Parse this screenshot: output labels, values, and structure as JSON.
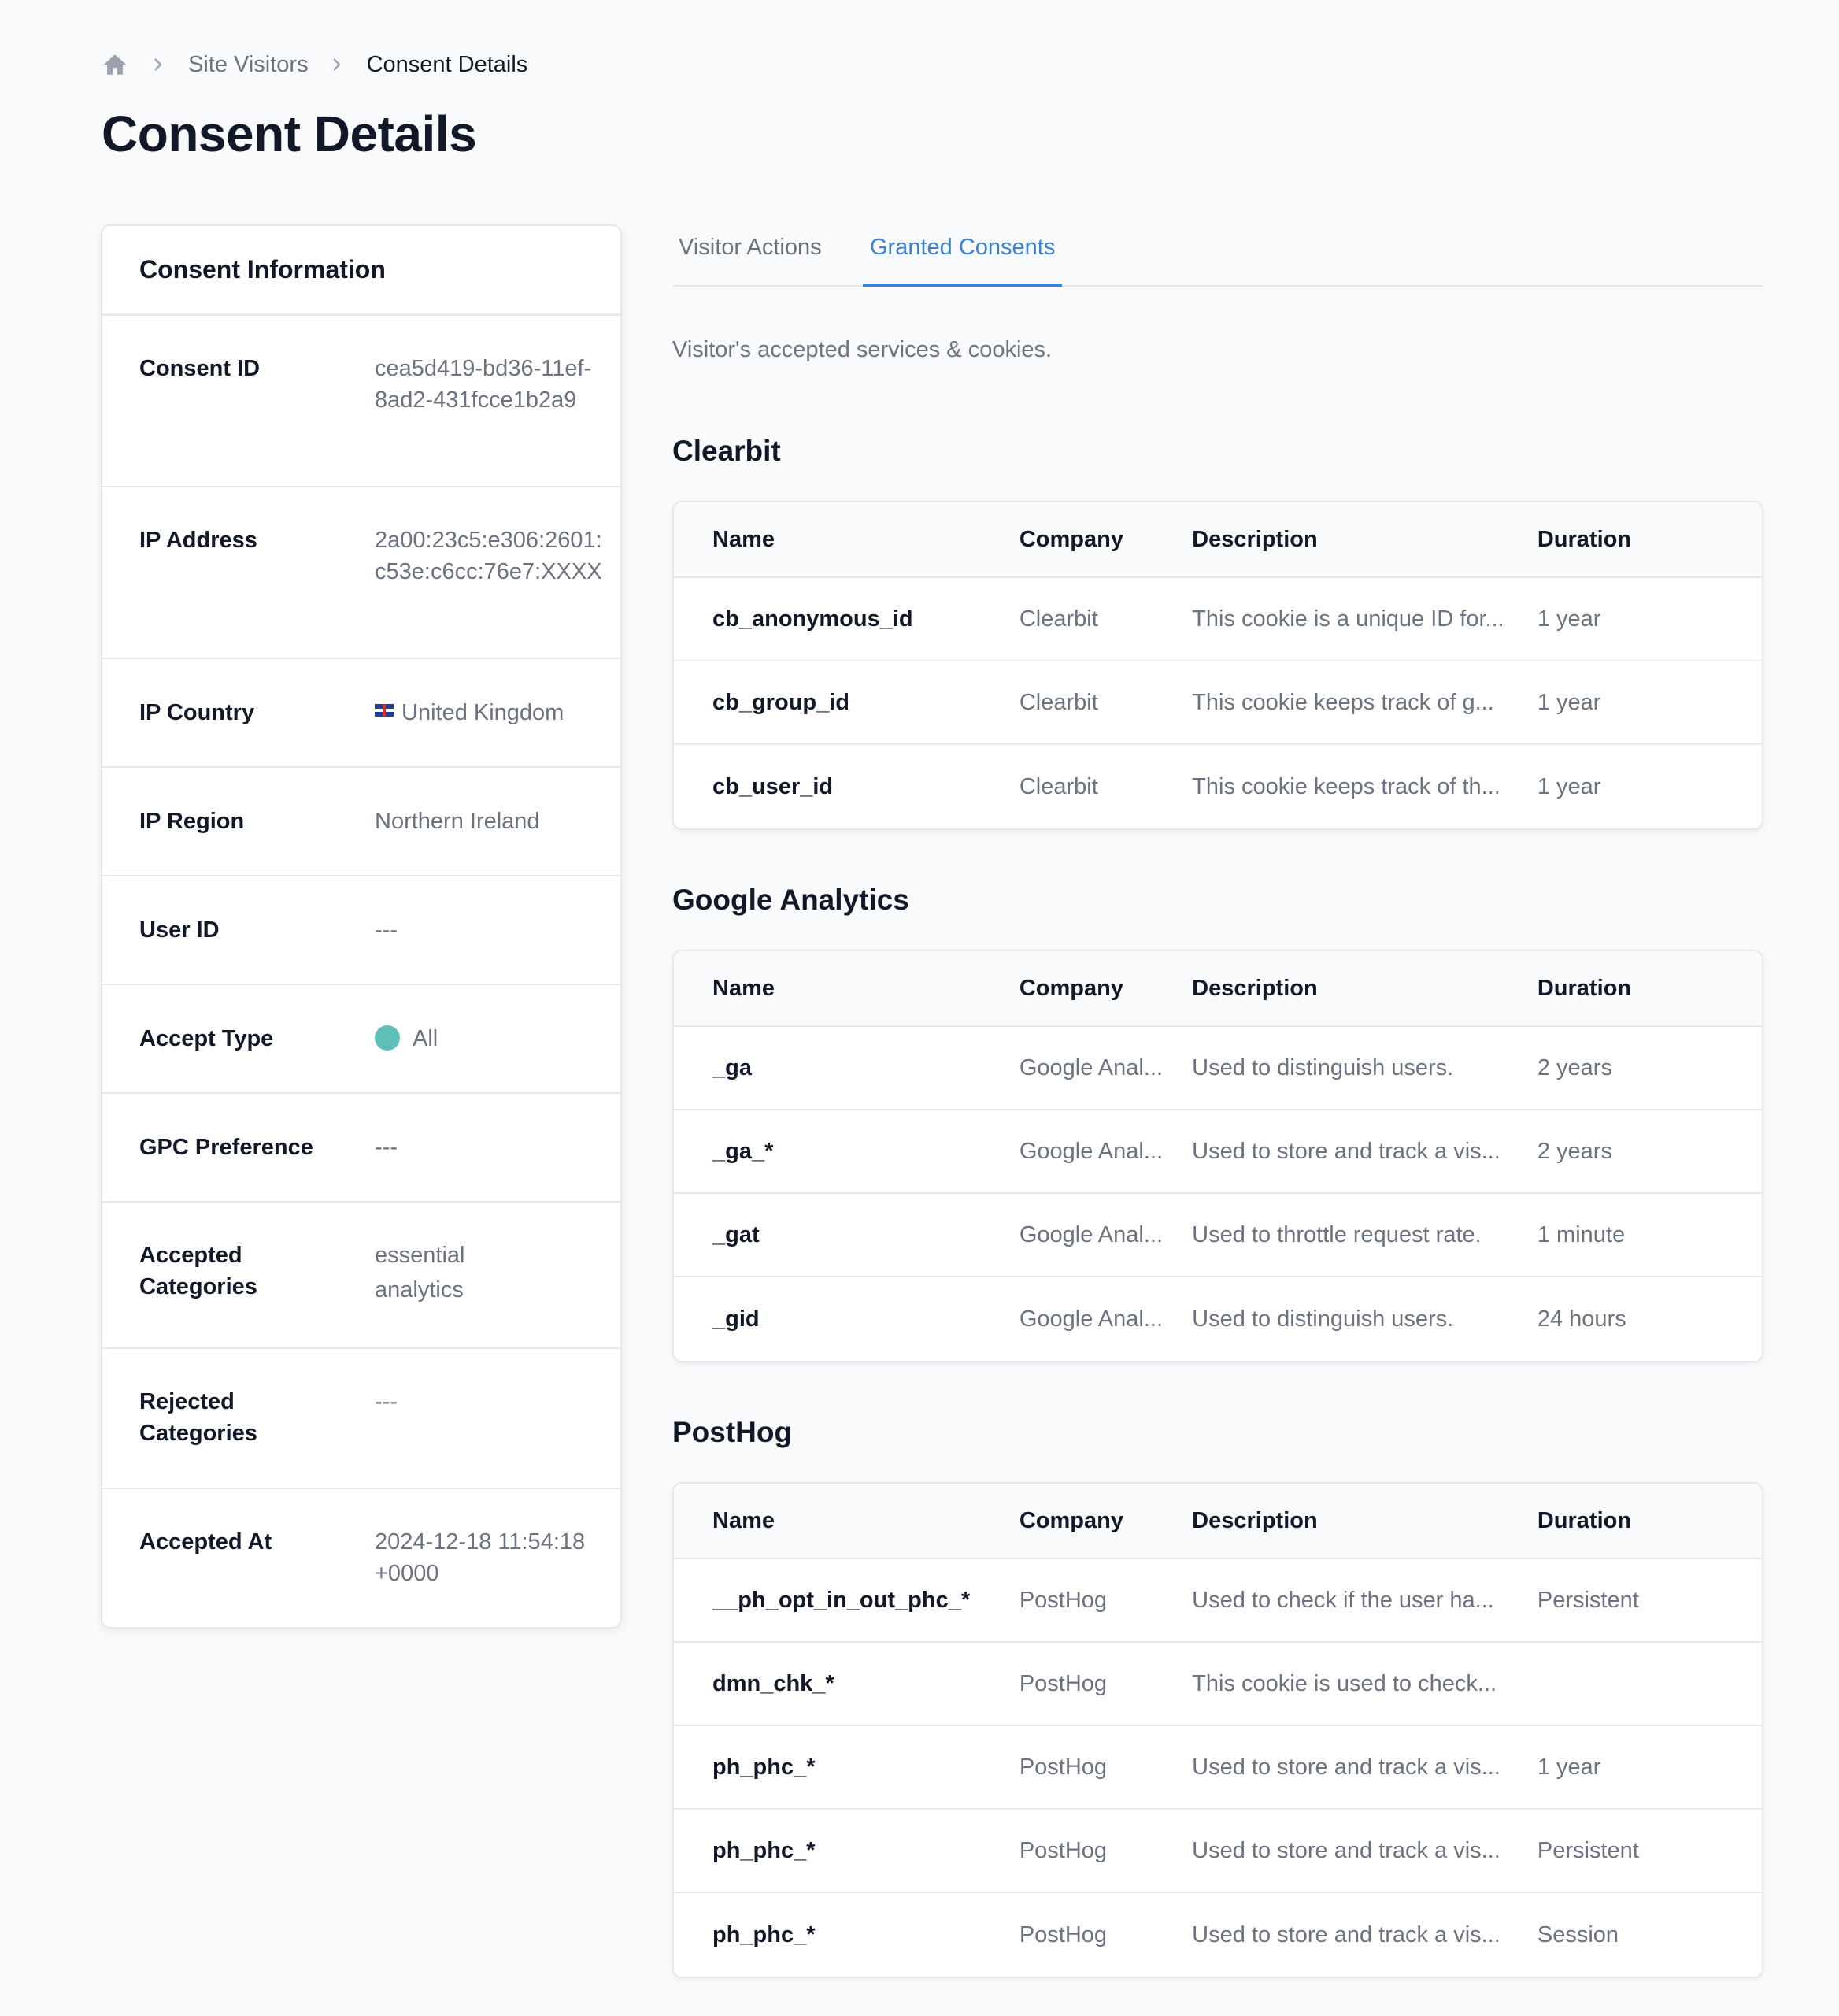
{
  "breadcrumb": {
    "home_icon": "home-icon",
    "items": [
      "Site Visitors",
      "Consent Details"
    ]
  },
  "page": {
    "title": "Consent Details"
  },
  "consent_info": {
    "title": "Consent Information",
    "rows": [
      {
        "label": "Consent ID",
        "value": "cea5d419-bd36-11ef-8ad2-431fcce1b2a9"
      },
      {
        "label": "IP Address",
        "value": "2a00:23c5:e306:2601:c53e:c6cc:76e7:XXXX"
      },
      {
        "label": "IP Country",
        "value": "United Kingdom",
        "icon": "uk-flag-icon"
      },
      {
        "label": "IP Region",
        "value": "Northern Ireland"
      },
      {
        "label": "User ID",
        "value": "---"
      },
      {
        "label": "Accept Type",
        "value": "All",
        "dot_color": "#5fc0b8"
      },
      {
        "label": "GPC Preference",
        "value": "---"
      },
      {
        "label": "Accepted Categories",
        "values": [
          "essential",
          "analytics"
        ]
      },
      {
        "label": "Rejected Categories",
        "value": "---"
      },
      {
        "label": "Accepted At",
        "value": "2024-12-18 11:54:18 +0000"
      }
    ]
  },
  "tabs": [
    {
      "label": "Visitor Actions",
      "active": false
    },
    {
      "label": "Granted Consents",
      "active": true
    }
  ],
  "subtitle": "Visitor's accepted services & cookies.",
  "table_headers": {
    "name": "Name",
    "company": "Company",
    "description": "Description",
    "duration": "Duration"
  },
  "groups": [
    {
      "title": "Clearbit",
      "rows": [
        {
          "name": "cb_anonymous_id",
          "company": "Clearbit",
          "description": "This cookie is a unique ID for...",
          "duration": "1 year"
        },
        {
          "name": "cb_group_id",
          "company": "Clearbit",
          "description": "This cookie keeps track of g...",
          "duration": "1 year"
        },
        {
          "name": "cb_user_id",
          "company": "Clearbit",
          "description": "This cookie keeps track of th...",
          "duration": "1 year"
        }
      ]
    },
    {
      "title": "Google Analytics",
      "rows": [
        {
          "name": "_ga",
          "company": "Google Anal...",
          "description": "Used to distinguish users.",
          "duration": "2 years"
        },
        {
          "name": "_ga_*",
          "company": "Google Anal...",
          "description": "Used to store and track a vis...",
          "duration": "2 years"
        },
        {
          "name": "_gat",
          "company": "Google Anal...",
          "description": "Used to throttle request rate.",
          "duration": "1 minute"
        },
        {
          "name": "_gid",
          "company": "Google Anal...",
          "description": "Used to distinguish users.",
          "duration": "24 hours"
        }
      ]
    },
    {
      "title": "PostHog",
      "rows": [
        {
          "name": "__ph_opt_in_out_phc_*",
          "company": "PostHog",
          "description": "Used to check if the user ha...",
          "duration": "Persistent"
        },
        {
          "name": "dmn_chk_*",
          "company": "PostHog",
          "description": "This cookie is used to check...",
          "duration": ""
        },
        {
          "name": "ph_phc_*",
          "company": "PostHog",
          "description": "Used to store and track a vis...",
          "duration": "1 year"
        },
        {
          "name": "ph_phc_*",
          "company": "PostHog",
          "description": "Used to store and track a vis...",
          "duration": "Persistent"
        },
        {
          "name": "ph_phc_*",
          "company": "PostHog",
          "description": "Used to store and track a vis...",
          "duration": "Session"
        }
      ]
    }
  ],
  "colors": {
    "accent": "#3b82d6",
    "accept_dot": "#5fc0b8"
  }
}
